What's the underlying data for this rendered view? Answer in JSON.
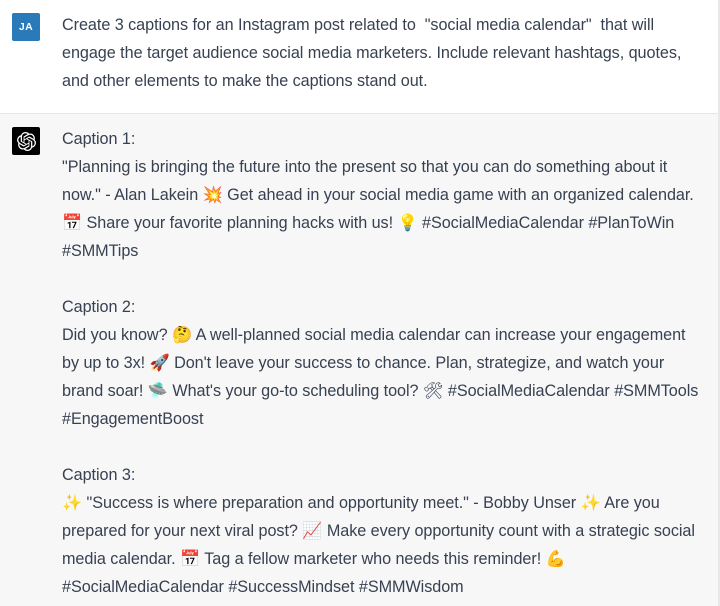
{
  "conversation": {
    "user_turn": {
      "avatar_initials": "JA",
      "avatar_color": "#2a7ab9",
      "message": "Create 3 captions for an Instagram post related to  \"social media calendar\"  that will engage the target audience social media marketers. Include relevant hashtags, quotes, and other elements to make the captions stand out."
    },
    "assistant_turn": {
      "avatar_icon": "openai-logo-icon",
      "avatar_color": "#000000",
      "background_color": "#f7f7f8",
      "blocks": [
        {
          "heading": "Caption 1:",
          "body": "\"Planning is bringing the future into the present so that you can do something about it now.\" - Alan Lakein 💥 Get ahead in your social media game with an organized calendar. 📅 Share your favorite planning hacks with us! 💡 #SocialMediaCalendar #PlanToWin #SMMTips"
        },
        {
          "heading": "Caption 2:",
          "body": "Did you know? 🤔 A well-planned social media calendar can increase your engagement by up to 3x! 🚀 Don't leave your success to chance. Plan, strategize, and watch your brand soar! 🛸 What's your go-to scheduling tool? 🛠 #SocialMediaCalendar #SMMTools #EngagementBoost"
        },
        {
          "heading": "Caption 3:",
          "body": "✨ \"Success is where preparation and opportunity meet.\" - Bobby Unser ✨ Are you prepared for your next viral post? 📈 Make every opportunity count with a strategic social media calendar. 📅 Tag a fellow marketer who needs this reminder! 💪 #SocialMediaCalendar #SuccessMindset #SMMWisdom"
        }
      ]
    }
  }
}
